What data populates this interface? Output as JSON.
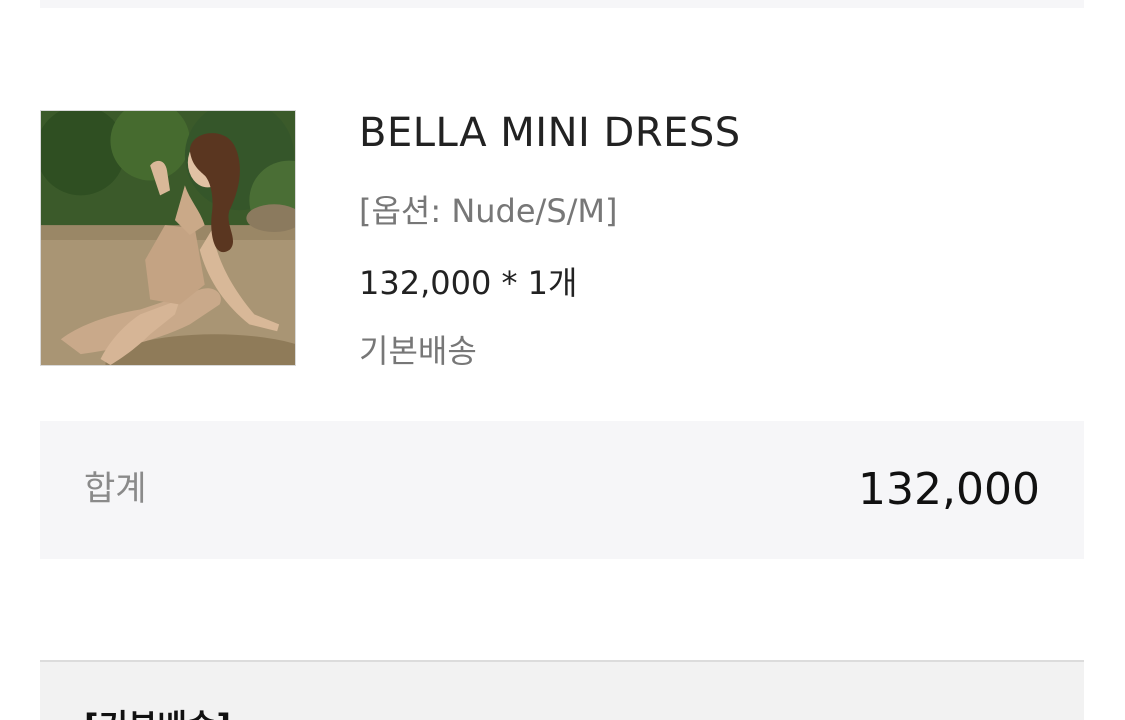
{
  "order_item": {
    "name": "BELLA MINI DRESS",
    "option": "[옵션: Nude/S/M]",
    "price_quantity": "132,000 * 1개",
    "shipping_type": "기본배송"
  },
  "summary": {
    "label": "합계",
    "total": "132,000"
  },
  "shipping_group": {
    "heading": "[기본배송]"
  },
  "colors": {
    "summary_background": "#f6f6f8",
    "muted_text": "#777777",
    "primary_text": "#222222"
  }
}
